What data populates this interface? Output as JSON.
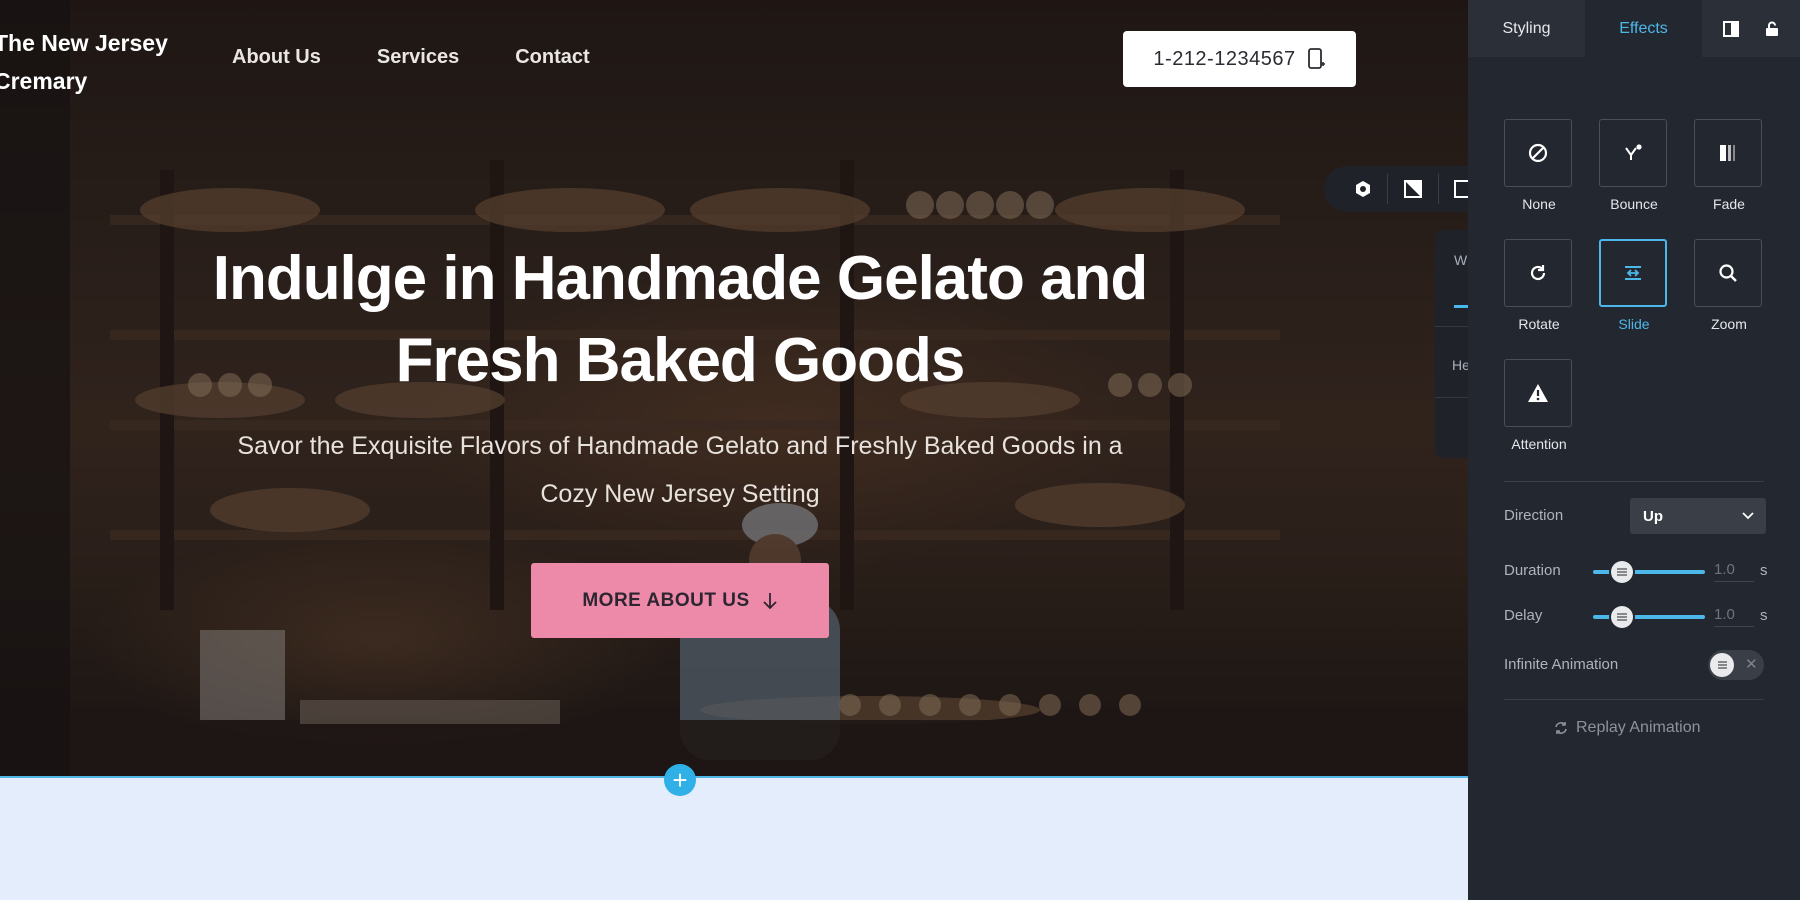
{
  "site": {
    "brand": "The New Jersey Cremary",
    "nav": [
      "About Us",
      "Services",
      "Contact"
    ],
    "phone": "1-212-1234567",
    "hero_title": "Indulge in Handmade Gelato and Fresh Baked Goods",
    "hero_subtitle": "Savor the Exquisite Flavors of Handmade Gelato and Freshly Baked Goods in a Cozy New Jersey Setting",
    "cta_label": "MORE ABOUT US",
    "add_section_glyph": "+"
  },
  "peek_panel": {
    "first": "W",
    "second": "He"
  },
  "panel": {
    "tabs": [
      "Styling",
      "Effects"
    ],
    "active_tab": "Effects",
    "tab_icons": [
      "layout-icon",
      "unlock-icon"
    ],
    "effects": [
      {
        "label": "None",
        "icon": "none-icon"
      },
      {
        "label": "Bounce",
        "icon": "bounce-icon"
      },
      {
        "label": "Fade",
        "icon": "fade-icon"
      },
      {
        "label": "Rotate",
        "icon": "rotate-icon"
      },
      {
        "label": "Slide",
        "icon": "slide-icon"
      },
      {
        "label": "Zoom",
        "icon": "zoom-icon"
      },
      {
        "label": "Attention",
        "icon": "attention-icon"
      }
    ],
    "selected_effect": "Slide",
    "direction": {
      "label": "Direction",
      "value": "Up"
    },
    "duration": {
      "label": "Duration",
      "value": "1.0",
      "unit": "s"
    },
    "delay": {
      "label": "Delay",
      "value": "1.0",
      "unit": "s"
    },
    "infinite": {
      "label": "Infinite Animation",
      "enabled": false
    },
    "replay_label": "Replay Animation"
  },
  "colors": {
    "accent": "#4cb8ea",
    "cta": "#ee8aa9",
    "panel_bg": "#23272f",
    "canvas_bg": "#e3edfb"
  }
}
